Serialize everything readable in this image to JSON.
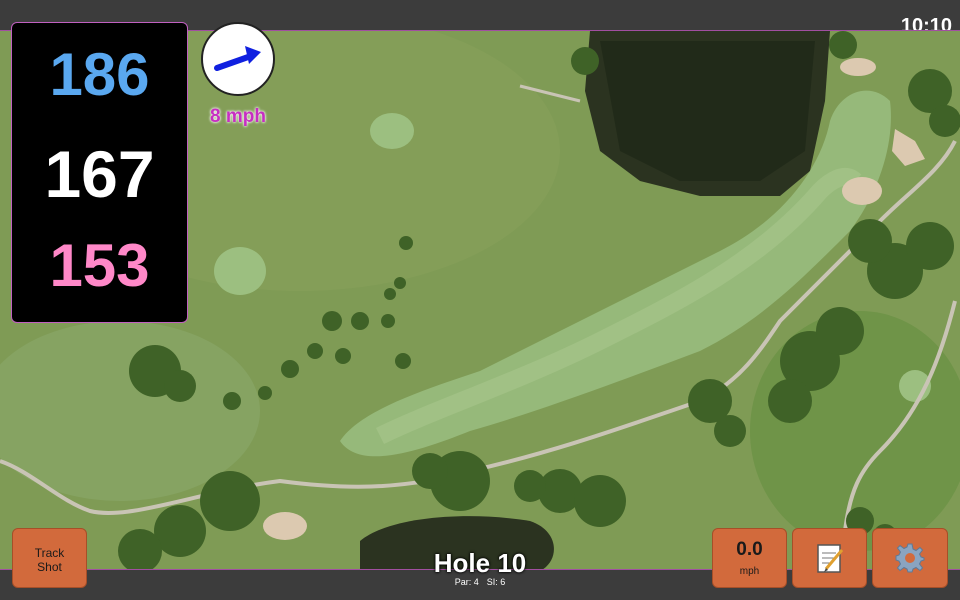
{
  "status_bar": {
    "time": "10:10"
  },
  "yardage": {
    "back": "186",
    "middle": "167",
    "front": "153"
  },
  "wind": {
    "speed_label": "8 mph",
    "direction_icon": "arrow-up-right-icon"
  },
  "hole": {
    "title": "Hole 10",
    "par": "Par: 4",
    "stroke_index": "SI: 6"
  },
  "buttons": {
    "track_shot": "Track\nShot",
    "speed_value": "0.0",
    "speed_unit": "mph",
    "notes_icon": "notepad-icon",
    "settings_icon": "gear-icon"
  },
  "colors": {
    "back_yardage": "#5aa8f0",
    "middle_yardage": "#ffffff",
    "front_yardage": "#ff88c8",
    "wind_text": "#c72ec2",
    "button_bg": "#d26a3c"
  }
}
